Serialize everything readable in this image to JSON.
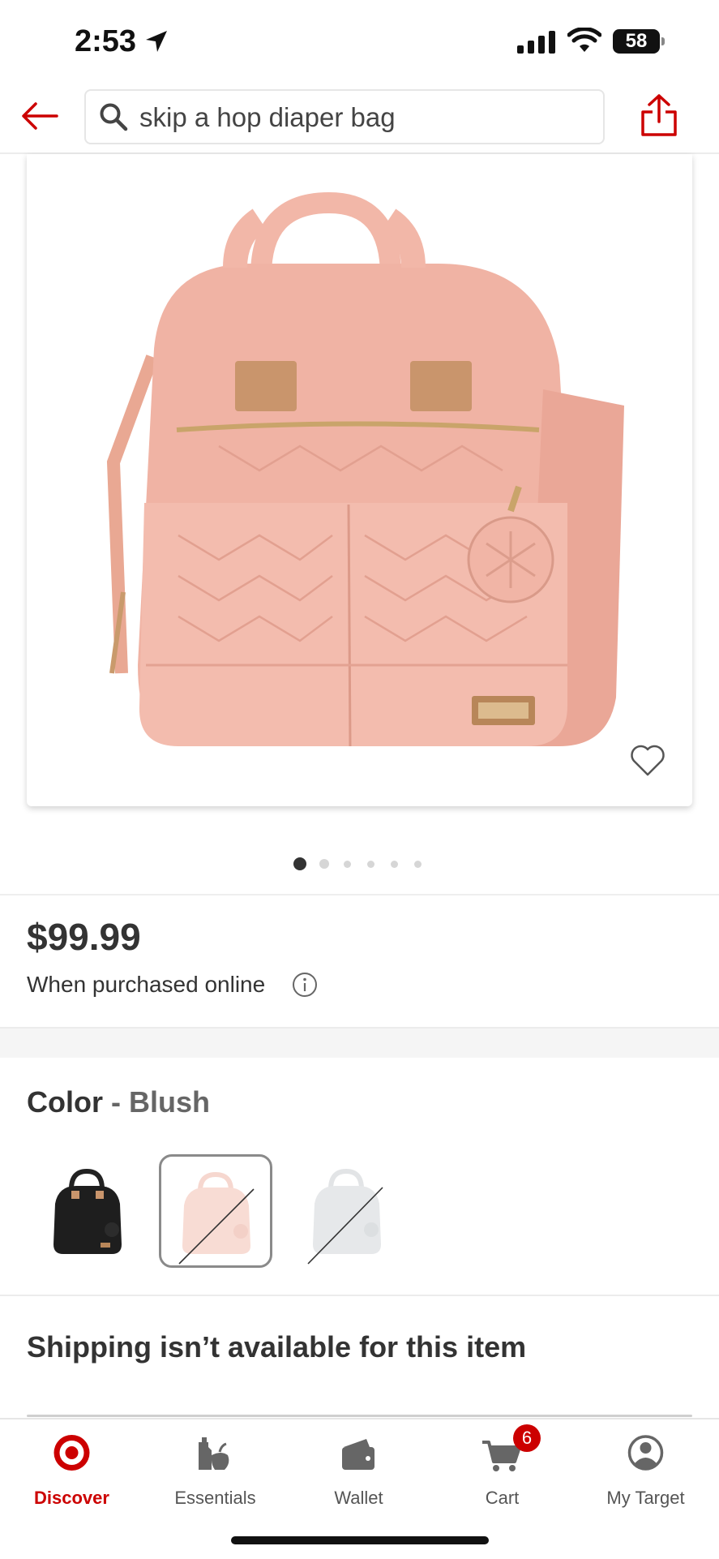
{
  "status_bar": {
    "time": "2:53",
    "battery": "58"
  },
  "search": {
    "query": "skip a hop diaper bag"
  },
  "product": {
    "price": "$99.99",
    "price_note": "When purchased online",
    "image_count": 6,
    "current_image": 1
  },
  "color": {
    "label": "Color",
    "separator": " - ",
    "selected": "Blush",
    "options": [
      "Black",
      "Blush",
      "Gray"
    ],
    "unavailable": [
      "Blush",
      "Gray"
    ]
  },
  "shipping": {
    "message": "Shipping isn’t available for this item"
  },
  "tabs": [
    {
      "label": "Discover",
      "active": true
    },
    {
      "label": "Essentials"
    },
    {
      "label": "Wallet"
    },
    {
      "label": "Cart",
      "badge": "6"
    },
    {
      "label": "My Target"
    }
  ],
  "colors": {
    "brand_red": "#cc0000",
    "text": "#333333",
    "blush": "#f0b9ad"
  }
}
